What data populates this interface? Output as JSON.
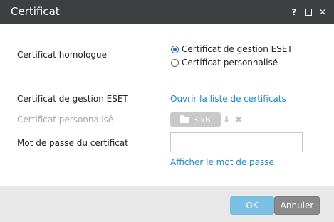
{
  "window": {
    "title": "Certificat",
    "controls": {
      "help": "?",
      "maximize_icon": "maximize-icon",
      "close": "✕"
    }
  },
  "form": {
    "homologous_label": "Certificat homologue",
    "radio_eset": "Certificat de gestion ESET",
    "radio_custom": "Certificat personnalisé",
    "selected_option": "eset",
    "eset_cert_label": "Certificat de gestion ESET",
    "eset_cert_link": "Ouvrir la liste de certificats",
    "custom_cert_label": "Certificat personnalisé",
    "custom_cert_file_size": "3 kB",
    "password_label": "Mot de passe du certificat",
    "password_value": "",
    "show_password_link": "Afficher le mot de passe"
  },
  "footer": {
    "ok_label": "OK",
    "cancel_label": "Annuler"
  },
  "colors": {
    "titlebar": "#3e3f41",
    "link": "#1b87c4",
    "ok_button": "#7cc0e6",
    "cancel_button": "#8a8a8a",
    "footer": "#e8e8e8"
  },
  "icons": [
    "help-icon",
    "maximize-icon",
    "close-icon",
    "radio-icon",
    "folder-icon",
    "download-icon",
    "delete-icon"
  ]
}
